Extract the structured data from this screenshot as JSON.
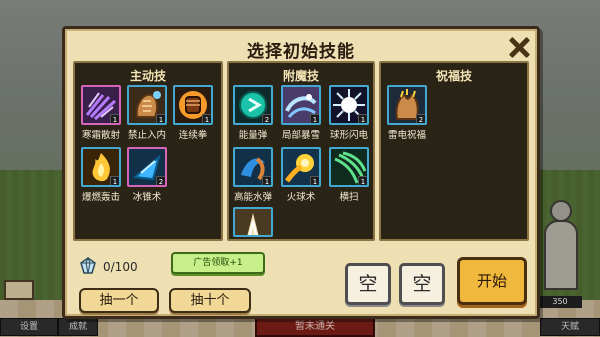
{
  "modal": {
    "title": "选择初始技能",
    "close_glyph": "close"
  },
  "panels": [
    {
      "title": "主动技",
      "skills": [
        {
          "name": "寒霜散射",
          "icon": "frost-scatter-icon",
          "count": "1"
        },
        {
          "name": "禁止入内",
          "icon": "no-entry-icon",
          "count": "1"
        },
        {
          "name": "连续拳",
          "icon": "combo-fist-icon",
          "count": "1"
        },
        {
          "name": "爆燃轰击",
          "icon": "blaze-strike-icon",
          "count": "1"
        },
        {
          "name": "冰锥术",
          "icon": "ice-cone-icon",
          "count": "2"
        }
      ]
    },
    {
      "title": "附魔技",
      "skills": [
        {
          "name": "能量弹",
          "icon": "energy-bolt-icon",
          "count": "2"
        },
        {
          "name": "局部暴雪",
          "icon": "blizzard-icon",
          "count": "1"
        },
        {
          "name": "球形闪电",
          "icon": "ball-lightning-icon",
          "count": "1"
        },
        {
          "name": "高能水弹",
          "icon": "water-bolt-icon",
          "count": "1"
        },
        {
          "name": "火球术",
          "icon": "fireball-icon",
          "count": "1"
        },
        {
          "name": "横扫",
          "icon": "sweep-icon",
          "count": "1"
        },
        {
          "name": "",
          "icon": "wind-pillar-icon",
          "count": ""
        }
      ]
    },
    {
      "title": "祝福技",
      "skills": [
        {
          "name": "雷电祝福",
          "icon": "thunder-blessing-icon",
          "count": "2"
        }
      ]
    }
  ],
  "currency": {
    "icon": "diamond-icon",
    "amount": "0/100"
  },
  "ad_button": {
    "label": "广告领取+1"
  },
  "draw_buttons": {
    "one": "抽一个",
    "ten": "抽十个"
  },
  "slots": [
    {
      "label": "空"
    },
    {
      "label": "空"
    }
  ],
  "start_button": {
    "label": "开始"
  },
  "background": {
    "bottom_left_1": "设置",
    "bottom_left_2": "成就",
    "bottom_center": "暂未通关",
    "bottom_right": "天赋",
    "level_chip": "350"
  },
  "colors": {
    "modal_bg": "#efe0b4",
    "panel_bg": "#2a2416",
    "accent_blue": "#44a9d2",
    "accent_pink": "#d565b9",
    "start_orange": "#f0b83d",
    "ad_green": "#c8f08a"
  }
}
